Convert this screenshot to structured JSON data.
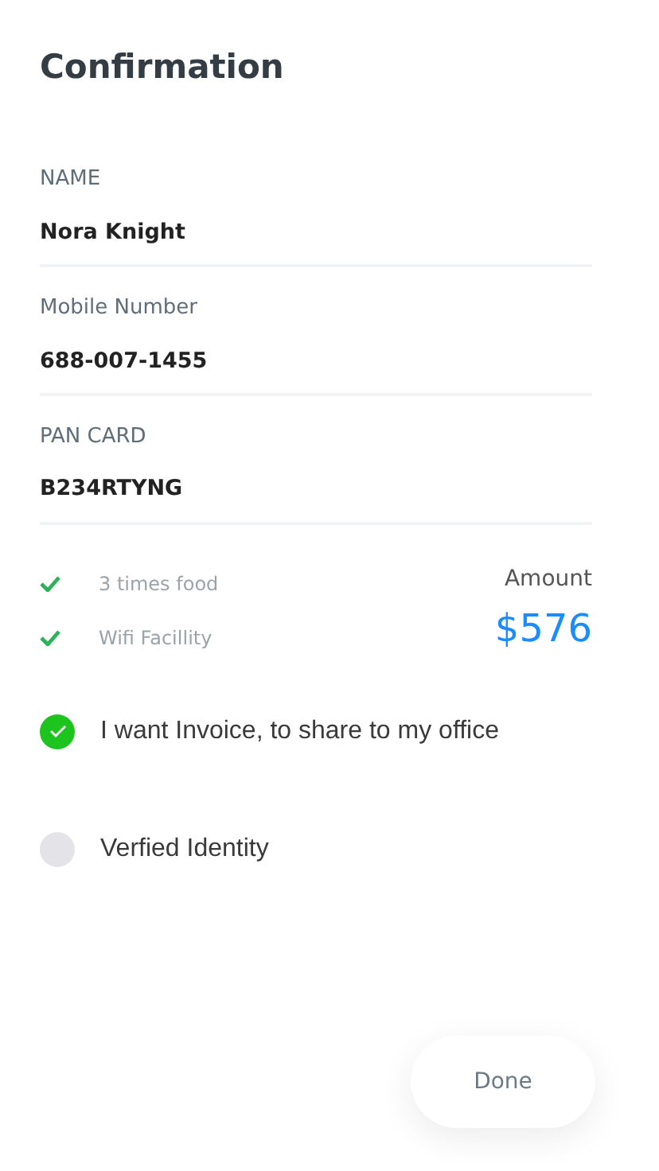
{
  "title": "Confirmation",
  "fields": [
    {
      "label": "NAME",
      "value": "Nora Knight"
    },
    {
      "label": "Mobile Number",
      "value": "688-007-1455"
    },
    {
      "label": "PAN CARD",
      "value": "B234RTYNG"
    }
  ],
  "features": [
    "3 times food",
    "Wifi Facillity"
  ],
  "amount": {
    "label": "Amount",
    "value": "$576"
  },
  "options": [
    {
      "label": "I want Invoice, to share to my office",
      "checked": true
    },
    {
      "label": "Verfied Identity",
      "checked": false
    }
  ],
  "button": "Done"
}
